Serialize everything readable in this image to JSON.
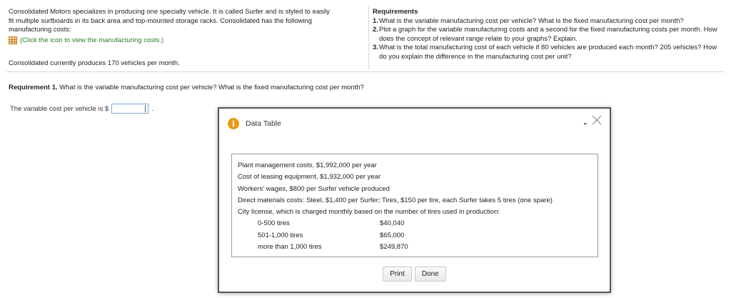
{
  "problem": {
    "lines": [
      "Consolidated Motors specializes in producing one specialty vehicle. It is called Surfer and is styled to easily",
      "fit multiple surfboards in its back area and top-mounted storage racks. Consolidated has the following",
      "manufacturing costs:"
    ],
    "link_text": "(Click the icon to view the manufacturing costs.)",
    "produces_text": "Consolidated currently produces 170 vehicles per month."
  },
  "requirements": {
    "title": "Requirements",
    "items": [
      {
        "num": "1.",
        "text": "What is the variable manufacturing cost per vehicle? What is the fixed manufacturing cost per month?"
      },
      {
        "num": "2.",
        "text": "Plot a graph for the variable manufacturing costs and a second for the fixed manufacturing costs per month. How does the concept of relevant range relate to your graphs? Explain."
      },
      {
        "num": "3.",
        "text": "What is the total manufacturing cost of each vehicle if 80 vehicles are produced each month? 205 vehicles? How do you explain the difference in the manufacturing cost per unit?"
      }
    ]
  },
  "requirement1": {
    "label": "Requirement 1.",
    "text": " What is the variable manufacturing cost per vehicle? What is the fixed manufacturing cost per month?"
  },
  "answer": {
    "prefix": "The variable cost per vehicle is $",
    "value": "",
    "suffix": "."
  },
  "modal": {
    "title": "Data Table",
    "minimize_label": "-",
    "lines": [
      "Plant management costs, $1,992,000 per year",
      "Cost of leasing equipment, $1,932,000 per year",
      "Workers' wages, $800 per Surfer vehicle produced",
      "Direct materials costs: Steel, $1,400 per Surfer; Tires, $150 per tire, each Surfer takes 5 tires (one spare)",
      "City license, which is charged monthly based on the number of tires used in production:"
    ],
    "tiers": [
      {
        "range": "0-500 tires",
        "cost": "$40,040"
      },
      {
        "range": "501-1,000 tires",
        "cost": "$65,000"
      },
      {
        "range": "more than 1,000 tires",
        "cost": "$249,870"
      }
    ],
    "print_label": "Print",
    "done_label": "Done"
  },
  "colors": {
    "link_green": "#2a7d2a",
    "info_orange": "#e89a13",
    "input_border": "#7fa7d8"
  },
  "icons": [
    "grid-table-icon",
    "info-icon",
    "close-icon",
    "minimize-icon"
  ]
}
